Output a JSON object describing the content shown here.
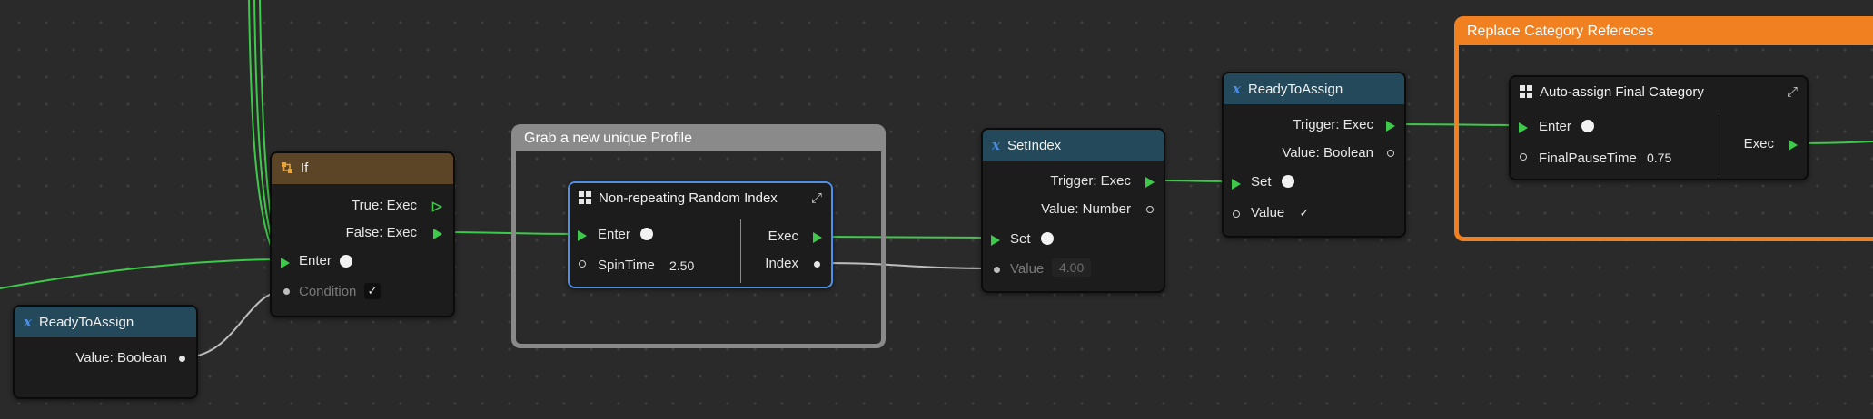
{
  "groups": {
    "grab": {
      "title": "Grab a new unique Profile"
    },
    "replace": {
      "title": "Replace Category Refereces"
    }
  },
  "nodes": {
    "ready_bottom": {
      "title": "ReadyToAssign",
      "value_label": "Value: Boolean"
    },
    "if_node": {
      "title": "If",
      "true_label": "True: Exec",
      "false_label": "False: Exec",
      "enter_label": "Enter",
      "condition_label": "Condition",
      "condition_checked": "✓"
    },
    "random_index": {
      "title": "Non-repeating Random Index",
      "enter_label": "Enter",
      "spintime_label": "SpinTime",
      "spintime_value": "2.50",
      "exec_label": "Exec",
      "index_label": "Index"
    },
    "set_index": {
      "title": "SetIndex",
      "trigger_label": "Trigger: Exec",
      "value_label": "Value: Number",
      "set_label": "Set",
      "value_in_label": "Value",
      "value_in_value": "4.00"
    },
    "ready_top": {
      "title": "ReadyToAssign",
      "trigger_label": "Trigger: Exec",
      "value_label": "Value: Boolean",
      "set_label": "Set",
      "value_in_label": "Value",
      "value_checked": "✓"
    },
    "auto_assign": {
      "title": "Auto-assign Final Category",
      "enter_label": "Enter",
      "pause_label": "FinalPauseTime",
      "pause_value": "0.75",
      "exec_label": "Exec"
    }
  },
  "colors": {
    "exec_wire": "#3ec94a",
    "data_wire": "#bdbdbd",
    "grab_group_border": "#8a8a8a",
    "replace_group_border": "#f08020",
    "selected_node_border": "#4f8fe6"
  }
}
